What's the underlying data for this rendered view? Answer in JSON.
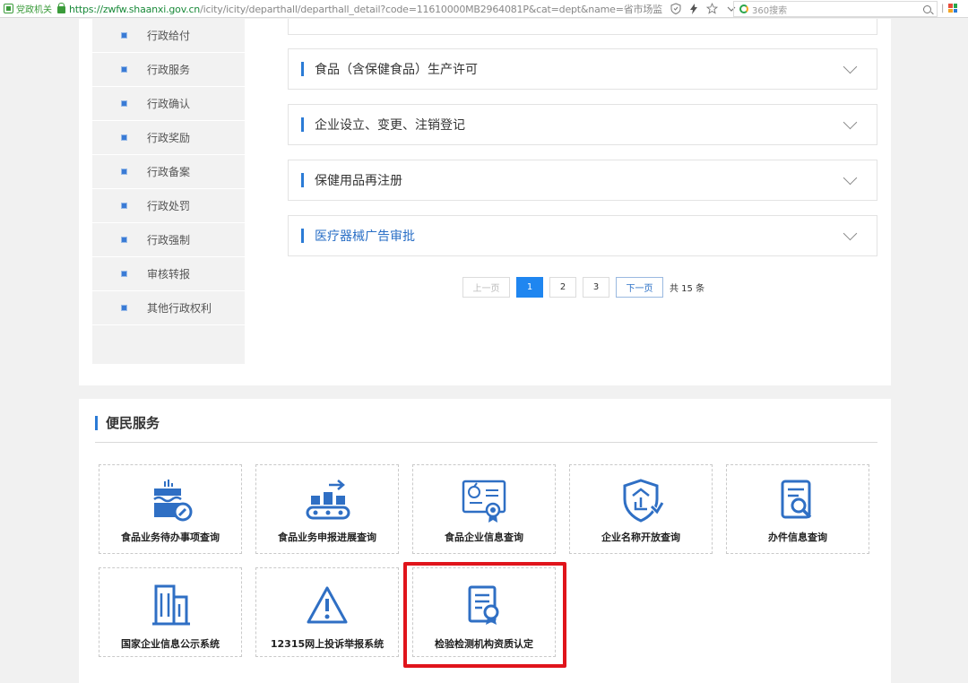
{
  "browser": {
    "security_label": "党政机关",
    "url_host": "https://zwfw.shaanxi.gov.cn",
    "url_path": "/icity/icity/departhall/departhall_detail?code=11610000MB2964081P&cat=dept&name=省市场监",
    "search_placeholder": "360搜索"
  },
  "sidebar": {
    "items": [
      {
        "label": "行政给付"
      },
      {
        "label": "行政服务"
      },
      {
        "label": "行政确认"
      },
      {
        "label": "行政奖励"
      },
      {
        "label": "行政备案"
      },
      {
        "label": "行政处罚"
      },
      {
        "label": "行政强制"
      },
      {
        "label": "审核转报"
      },
      {
        "label": "其他行政权利"
      }
    ]
  },
  "accordion": {
    "items": [
      {
        "title": "食品（含保健食品）生产许可"
      },
      {
        "title": "企业设立、变更、注销登记"
      },
      {
        "title": "保健用品再注册"
      },
      {
        "title": "医疗器械广告审批"
      }
    ]
  },
  "pagination": {
    "prev_label": "上一页",
    "pages": [
      "1",
      "2",
      "3"
    ],
    "current_page": "1",
    "next_label": "下一页",
    "total_label": "共 15 条"
  },
  "services": {
    "title": "便民服务",
    "items": [
      {
        "label": "食品业务待办事项查询",
        "icon": "food-todo-icon"
      },
      {
        "label": "食品业务申报进展查询",
        "icon": "conveyor-progress-icon"
      },
      {
        "label": "食品企业信息查询",
        "icon": "certificate-icon"
      },
      {
        "label": "企业名称开放查询",
        "icon": "shield-enterprise-icon"
      },
      {
        "label": "办件信息查询",
        "icon": "document-search-icon"
      },
      {
        "label": "国家企业信息公示系统",
        "icon": "building-icon"
      },
      {
        "label": "12315网上投诉举报系统",
        "icon": "warning-icon"
      },
      {
        "label": "检验检测机构资质认定",
        "icon": "certified-document-icon"
      }
    ],
    "highlighted_index": 7
  },
  "colors": {
    "accent": "#2b7bd6",
    "icon_blue": "#2f6fc4",
    "pager_active": "#1f86f0",
    "highlight_red": "#e0141b"
  }
}
